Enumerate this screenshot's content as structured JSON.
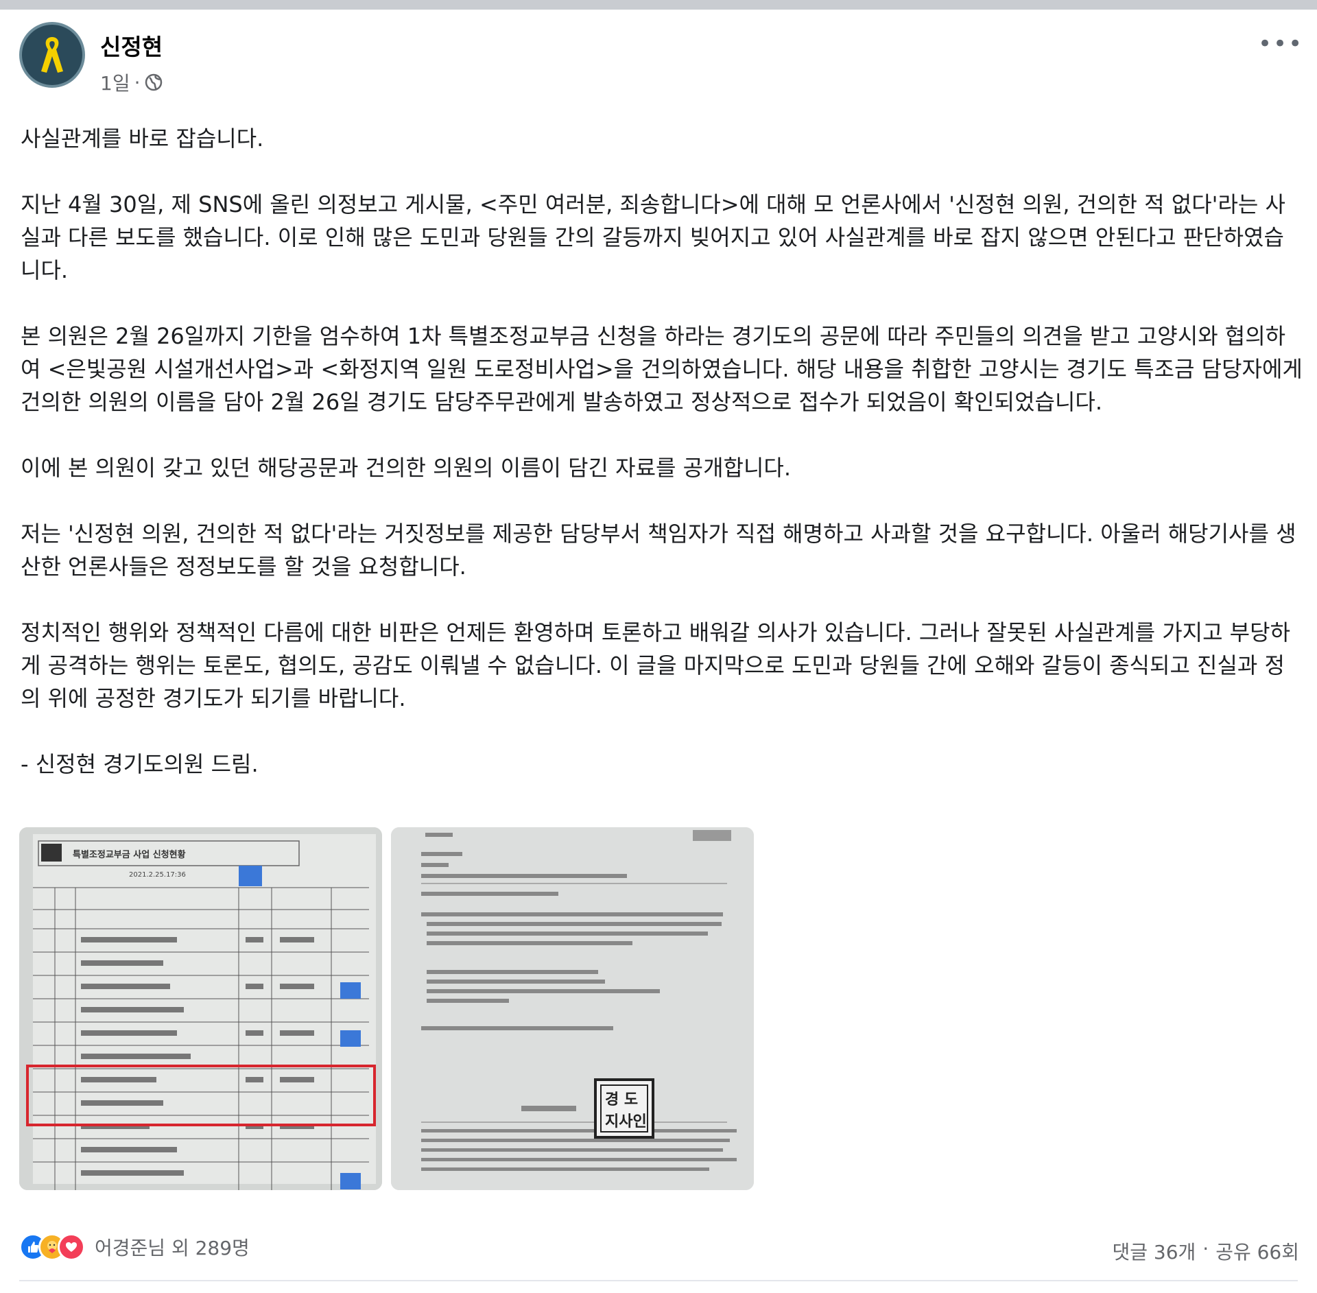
{
  "post": {
    "author": "신정현",
    "time": "1일",
    "separator": "·",
    "paragraphs": [
      "사실관계를 바로 잡습니다.",
      "지난 4월 30일, 제 SNS에 올린 의정보고 게시물, <주민 여러분, 죄송합니다>에 대해 모 언론사에서 '신정현 의원, 건의한 적 없다'라는 사실과 다른 보도를 했습니다. 이로 인해 많은 도민과 당원들 간의 갈등까지 빚어지고 있어 사실관계를 바로 잡지 않으면 안된다고 판단하였습니다.",
      "본 의원은 2월 26일까지 기한을 엄수하여 1차 특별조정교부금 신청을 하라는 경기도의 공문에 따라 주민들의 의견을 받고 고양시와 협의하여 <은빛공원 시설개선사업>과 <화정지역 일원 도로정비사업>을 건의하였습니다. 해당 내용을 취합한 고양시는 경기도 특조금 담당자에게 건의한 의원의 이름을 담아 2월 26일 경기도 담당주무관에게 발송하였고 정상적으로 접수가 되었음이 확인되었습니다.",
      "이에 본 의원이 갖고 있던 해당공문과 건의한 의원의 이름이 담긴 자료를 공개합니다.",
      "저는 '신정현 의원, 건의한 적 없다'라는 거짓정보를 제공한 담당부서 책임자가 직접 해명하고 사과할 것을 요구합니다. 아울러 해당기사를 생산한 언론사들은 정정보도를 할 것을 요청합니다.",
      "정치적인 행위와 정책적인 다름에 대한 비판은 언제든 환영하며 토론하고 배워갈 의사가 있습니다. 그러나 잘못된 사실관계를 가지고 부당하게 공격하는 행위는 토론도, 협의도, 공감도 이뤄낼 수 없습니다. 이 글을 마지막으로 도민과 당원들 간에 오해와 갈등이 종식되고 진실과 정의 위에 공정한 경기도가 되기를 바랍니다."
    ],
    "signature": "- 신정현 경기도의원 드림."
  },
  "photos": {
    "photo1": {
      "header": "특별조정교부금 사업 신청현황",
      "date_line": "2021.2.25.17:36"
    },
    "photo2": {
      "stamp": "경기도 지사인"
    }
  },
  "reactions": {
    "icons": [
      "like-icon",
      "care-icon",
      "love-icon"
    ],
    "text": "어경준님 외 289명",
    "comments": "댓글 36개",
    "dot": "·",
    "shares": "공유 66회"
  },
  "colors": {
    "like": "#1877f2",
    "care": "#f7b125",
    "love": "#f33e58",
    "secondary_text": "#65676b",
    "highlight_box": "#d7262e",
    "redaction": "#3b78d8"
  }
}
